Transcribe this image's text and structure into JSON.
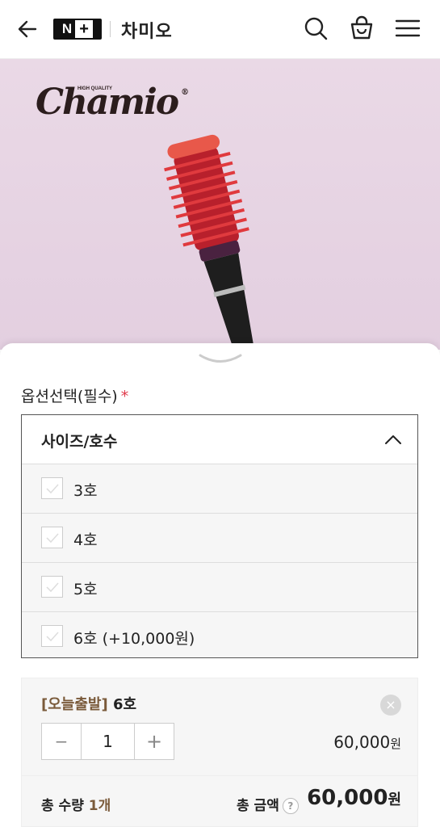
{
  "header": {
    "logo_text": "N",
    "logo_plus": "+",
    "store_name": "차미오"
  },
  "hero": {
    "brand_name": "Chamio",
    "brand_tagline": "HIGH QUALITY",
    "brand_mark": "®"
  },
  "options": {
    "title": "옵션선택(필수)",
    "required_mark": "*",
    "select_label": "사이즈/호수",
    "items": [
      {
        "label": "3호"
      },
      {
        "label": "4호"
      },
      {
        "label": "5호"
      },
      {
        "label": "6호 (+10,000원)"
      }
    ]
  },
  "cart_item": {
    "tag": "[오늘출발]",
    "name": "6호",
    "remove_label": "×",
    "quantity": "1",
    "minus": "−",
    "plus": "+",
    "price": "60,000",
    "currency": "원"
  },
  "summary": {
    "qty_label": "총 수량",
    "qty_value": "1개",
    "amount_label": "총 금액",
    "help": "?",
    "amount": "60,000",
    "currency": "원"
  },
  "colors": {
    "accent_brown": "#7a5a3a",
    "required_red": "#e0394a",
    "hero_bg": "#e6d4e3",
    "brush_red": "#d9303a"
  }
}
